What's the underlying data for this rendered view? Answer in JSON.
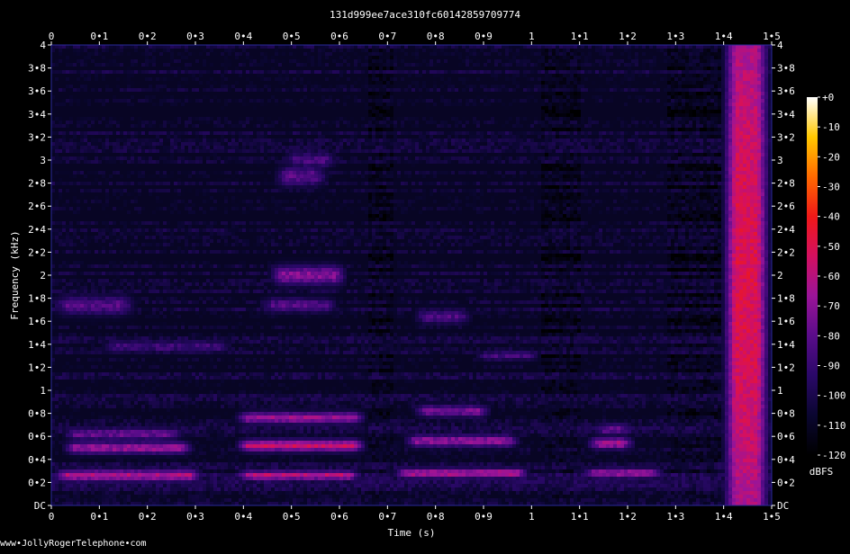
{
  "chart_data": {
    "type": "heatmap",
    "title": "131d999ee7ace310fc60142859709774",
    "xlabel": "Time (s)",
    "ylabel": "Frequency (kHz)",
    "xlim": [
      0,
      1.5
    ],
    "ylim": [
      0,
      4
    ],
    "x_ticks": [
      "0",
      "0•1",
      "0•2",
      "0•3",
      "0•4",
      "0•5",
      "0•6",
      "0•7",
      "0•8",
      "0•9",
      "1",
      "1•1",
      "1•2",
      "1•3",
      "1•4",
      "1•5"
    ],
    "x_tick_values": [
      0,
      0.1,
      0.2,
      0.3,
      0.4,
      0.5,
      0.6,
      0.7,
      0.8,
      0.9,
      1.0,
      1.1,
      1.2,
      1.3,
      1.4,
      1.5
    ],
    "y_ticks": [
      "DC",
      "0•2",
      "0•4",
      "0•6",
      "0•8",
      "1",
      "1•2",
      "1•4",
      "1•6",
      "1•8",
      "2",
      "2•2",
      "2•4",
      "2•6",
      "2•8",
      "3",
      "3•2",
      "3•4",
      "3•6",
      "3•8",
      "4"
    ],
    "y_tick_values": [
      0,
      0.2,
      0.4,
      0.6,
      0.8,
      1.0,
      1.2,
      1.4,
      1.6,
      1.8,
      2.0,
      2.2,
      2.4,
      2.6,
      2.8,
      3.0,
      3.2,
      3.4,
      3.6,
      3.8,
      4.0
    ],
    "colorbar": {
      "label": "dBFS",
      "range": [
        -120,
        0
      ],
      "ticks": [
        "+0",
        "-10",
        "-20",
        "-30",
        "-40",
        "-50",
        "-60",
        "-70",
        "-80",
        "-90",
        "-100",
        "-110",
        "-120"
      ],
      "tick_values": [
        0,
        -10,
        -20,
        -30,
        -40,
        -50,
        -60,
        -70,
        -80,
        -90,
        -100,
        -110,
        -120
      ],
      "colormap": [
        "#000000",
        "#0a0630",
        "#2a0868",
        "#5a0c8a",
        "#9a1498",
        "#d41060",
        "#f01818",
        "#ff6a00",
        "#ffc800",
        "#ffffff"
      ]
    },
    "background_level_db": -110,
    "bands": [
      {
        "t0": 0.0,
        "t1": 0.32,
        "f": 0.26,
        "fw": 0.05,
        "db": -62
      },
      {
        "t0": 0.02,
        "t1": 0.3,
        "f": 0.5,
        "fw": 0.05,
        "db": -66
      },
      {
        "t0": 0.02,
        "t1": 0.28,
        "f": 0.62,
        "fw": 0.05,
        "db": -78
      },
      {
        "t0": 0.0,
        "t1": 0.18,
        "f": 1.74,
        "fw": 0.08,
        "db": -82
      },
      {
        "t0": 0.1,
        "t1": 0.38,
        "f": 1.38,
        "fw": 0.05,
        "db": -88
      },
      {
        "t0": 0.38,
        "t1": 0.65,
        "f": 0.26,
        "fw": 0.04,
        "db": -60
      },
      {
        "t0": 0.38,
        "t1": 0.66,
        "f": 0.52,
        "fw": 0.05,
        "db": -56
      },
      {
        "t0": 0.38,
        "t1": 0.66,
        "f": 0.76,
        "fw": 0.05,
        "db": -66
      },
      {
        "t0": 0.45,
        "t1": 0.62,
        "f": 2.0,
        "fw": 0.08,
        "db": -70
      },
      {
        "t0": 0.43,
        "t1": 0.6,
        "f": 1.74,
        "fw": 0.06,
        "db": -82
      },
      {
        "t0": 0.46,
        "t1": 0.58,
        "f": 2.86,
        "fw": 0.08,
        "db": -80
      },
      {
        "t0": 0.48,
        "t1": 0.6,
        "f": 3.0,
        "fw": 0.06,
        "db": -84
      },
      {
        "t0": 0.71,
        "t1": 1.0,
        "f": 0.28,
        "fw": 0.04,
        "db": -60
      },
      {
        "t0": 0.73,
        "t1": 0.98,
        "f": 0.56,
        "fw": 0.05,
        "db": -68
      },
      {
        "t0": 0.75,
        "t1": 0.92,
        "f": 0.82,
        "fw": 0.05,
        "db": -74
      },
      {
        "t0": 0.75,
        "t1": 0.88,
        "f": 1.64,
        "fw": 0.06,
        "db": -84
      },
      {
        "t0": 0.88,
        "t1": 1.02,
        "f": 1.3,
        "fw": 0.04,
        "db": -86
      },
      {
        "t0": 1.1,
        "t1": 1.28,
        "f": 0.28,
        "fw": 0.04,
        "db": -66
      },
      {
        "t0": 1.11,
        "t1": 1.22,
        "f": 0.54,
        "fw": 0.05,
        "db": -64
      },
      {
        "t0": 1.12,
        "t1": 1.22,
        "f": 0.66,
        "fw": 0.05,
        "db": -80
      },
      {
        "t0": 1.395,
        "t1": 1.5,
        "f": 2.0,
        "fw": 4.0,
        "db": -50
      }
    ],
    "grid": false,
    "legend": "colorbar-right"
  },
  "watermark": "www•JollyRogerTelephone•com"
}
